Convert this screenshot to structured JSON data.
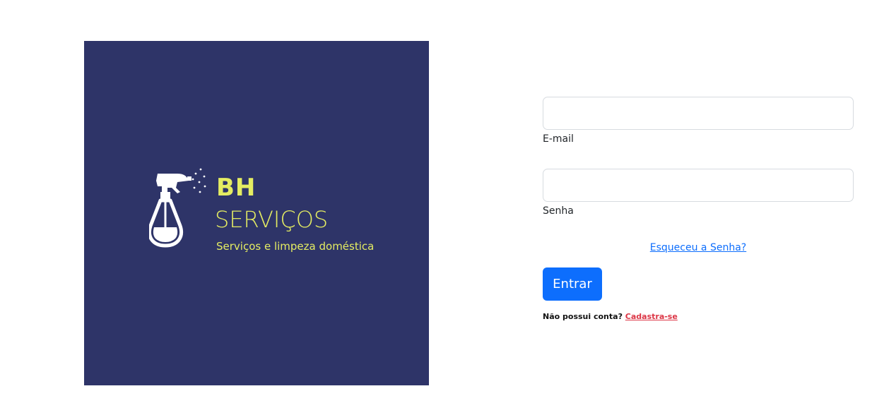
{
  "brand": {
    "short": "BH",
    "name": "SERVIÇOS",
    "tagline": "Serviços e limpeza doméstica",
    "logo_icon": "spray-bottle-icon",
    "panel_color": "#2e3468",
    "text_color": "#e4ec62"
  },
  "login_form": {
    "email": {
      "value": "",
      "label": "E-mail"
    },
    "password": {
      "value": "",
      "label": "Senha"
    },
    "forgot_password_link": "Esqueceu a Senha?",
    "submit_label": "Entrar",
    "signup_prompt": "Não possui conta?",
    "signup_link": "Cadastra-se",
    "accent_color": "#0d6efd",
    "signup_link_color": "#dc3545"
  }
}
